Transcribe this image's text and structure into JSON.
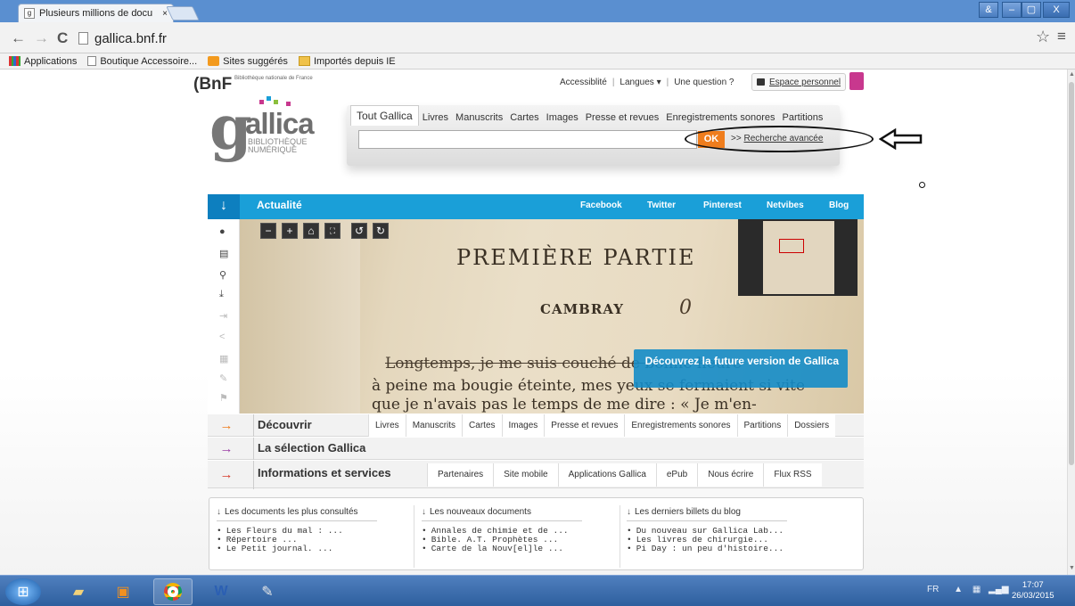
{
  "browser": {
    "tab_title": "Plusieurs millions de docu",
    "tab_close": "×",
    "url": "gallica.bnf.fr",
    "back": "←",
    "forward": "→",
    "reload": "C",
    "star": "☆",
    "menu": "≡",
    "window_controls": [
      "&",
      "–",
      "▢",
      "X"
    ]
  },
  "bookmarks": [
    {
      "label": "Applications",
      "icon": "apps-grid-icon"
    },
    {
      "label": "Boutique Accessoire...",
      "icon": "page-icon"
    },
    {
      "label": "Sites suggérés",
      "icon": "suggested-icon"
    },
    {
      "label": "Importés depuis IE",
      "icon": "folder-icon"
    }
  ],
  "header": {
    "bnf_logo": "(BnF",
    "bnf_sub": "Bibliothèque nationale de France",
    "accessibility": "Accessiblité",
    "languages": "Langues ▾",
    "question": "Une question ?",
    "espace": "Espace personnel"
  },
  "logo": {
    "g": "g",
    "allica": "allica",
    "sub1": "BIBLIOTHÈQUE",
    "sub2": "NUMÉRIQUE"
  },
  "search": {
    "tabs": [
      "Tout Gallica",
      "Livres",
      "Manuscrits",
      "Cartes",
      "Images",
      "Presse et revues",
      "Enregistrements sonores",
      "Partitions"
    ],
    "value": "",
    "ok": "OK",
    "advanced_prefix": ">>",
    "advanced": "Recherche avancée"
  },
  "actualite": {
    "arrow": "↓",
    "label": "Actualité",
    "social": [
      "Facebook",
      "Twitter",
      "Pinterest",
      "Netvibes",
      "Blog"
    ]
  },
  "viewer": {
    "controls": [
      "−",
      "+",
      "⌂",
      "⛶",
      "↺",
      "↻"
    ],
    "side_icons": [
      "info-icon",
      "document-icon",
      "zoom-icon",
      "download-icon",
      "export-icon",
      "share-icon",
      "print-icon",
      "bookmark-icon",
      "flag-icon"
    ],
    "line1": "PREMIÈRE   PARTIE",
    "line2": "CAMBRAY",
    "line2b": "0",
    "line3": "Longtemps, je me suis couché de bonne heure",
    "line4": "à peine ma bougie éteinte, mes yeux se fermaient si vite",
    "line5": "que je n'avais pas le temps de me dire : « Je m'en-",
    "promo": "Découvrez la future version de Gallica"
  },
  "rows": [
    {
      "arrow": "→",
      "arrow_color": "#ef7d1d",
      "label": "Découvrir",
      "links": [
        "Livres",
        "Manuscrits",
        "Cartes",
        "Images",
        "Presse et revues",
        "Enregistrements sonores",
        "Partitions",
        "Dossiers"
      ]
    },
    {
      "arrow": "→",
      "arrow_color": "#9b3fa6",
      "label": "La sélection Gallica",
      "links": []
    },
    {
      "arrow": "→",
      "arrow_color": "#d63a2a",
      "label": "Informations et services",
      "links": [
        "Partenaires",
        "Site mobile",
        "Applications Gallica",
        "ePub",
        "Nous écrire",
        "Flux RSS"
      ]
    }
  ],
  "panels": [
    {
      "title": "Les documents les plus consultés",
      "items": [
        "Les Fleurs du mal : ...",
        "Répertoire ...",
        "Le Petit journal. ..."
      ]
    },
    {
      "title": "Les nouveaux documents",
      "items": [
        "Annales de chimie et de ...",
        "Bible. A.T. Prophètes ...",
        "Carte de la Nouv[el]le ..."
      ]
    },
    {
      "title": "Les derniers billets du blog",
      "items": [
        "Du nouveau sur Gallica Lab...",
        "Les livres de chirurgie...",
        "Pi Day : un peu d'histoire..."
      ]
    }
  ],
  "taskbar": {
    "lang": "FR",
    "time": "17:07",
    "date": "26/03/2015"
  },
  "colors": {
    "accent": "#1a9fd8",
    "ok": "#ef7d1d",
    "brand": "#c8388e"
  }
}
